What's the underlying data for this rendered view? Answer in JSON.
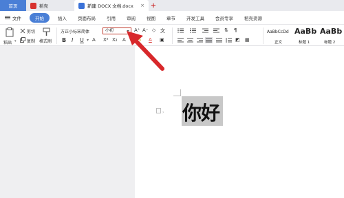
{
  "titlebar": {
    "tabs": [
      {
        "label": "首页"
      },
      {
        "label": "稻壳"
      },
      {
        "label": "新建 DOCX 文档.docx"
      }
    ],
    "close_glyph": "×",
    "new_tab_glyph": "+"
  },
  "menubar": {
    "items": [
      "文件",
      "开始",
      "插入",
      "页面布局",
      "引用",
      "审阅",
      "视图",
      "章节",
      "开发工具",
      "会员专享",
      "稻壳资源"
    ],
    "active": "开始"
  },
  "ribbon": {
    "cut": "剪切",
    "copy": "复制",
    "format_painter": "格式刷",
    "paste": "粘贴",
    "font_family": "方正小标宋简体",
    "font_size": "小初",
    "bold": "B",
    "italic": "I",
    "underline": "U",
    "styles": [
      {
        "preview": "AaBbCcDd",
        "name": "正文"
      },
      {
        "preview": "AaBb",
        "name": "标题 1"
      },
      {
        "preview": "AaBb",
        "name": "标题 2"
      }
    ]
  },
  "document": {
    "text": "你好"
  },
  "colors": {
    "accent": "#4a7fd6",
    "annotation_arrow": "#d8282b"
  },
  "icons": [
    "menu-icon",
    "cut-icon",
    "copy-icon",
    "paste-icon",
    "format-painter-icon",
    "font-grow-icon",
    "font-shrink-icon",
    "clear-format-icon",
    "bullet-list-icon",
    "numbered-list-icon",
    "align-left-icon",
    "align-center-icon",
    "align-right-icon",
    "justify-icon",
    "highlight-icon",
    "font-color-icon"
  ]
}
